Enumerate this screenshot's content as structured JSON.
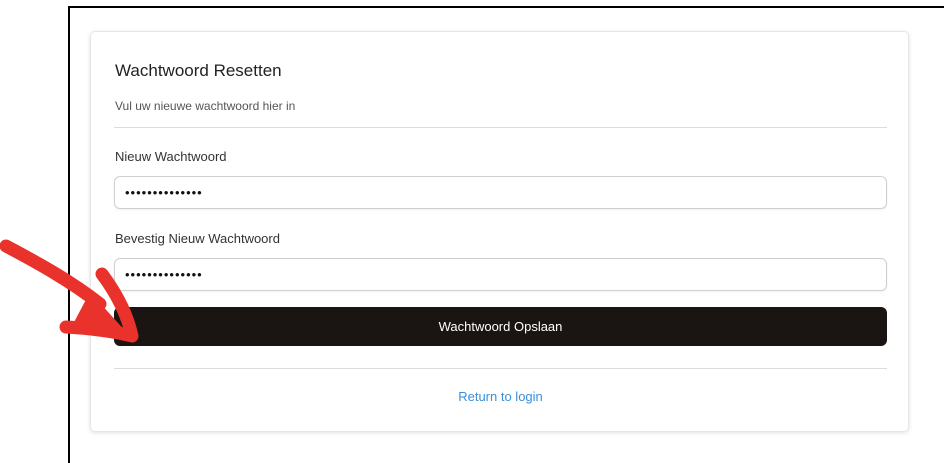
{
  "card": {
    "title": "Wachtwoord Resetten",
    "subtitle": "Vul uw nieuwe wachtwoord hier in"
  },
  "fields": {
    "new_password_label": "Nieuw Wachtwoord",
    "new_password_value": "••••••••••••••",
    "confirm_password_label": "Bevestig Nieuw Wachtwoord",
    "confirm_password_value": "••••••••••••••"
  },
  "actions": {
    "save_label": "Wachtwoord Opslaan",
    "return_label": "Return to login"
  },
  "annotation": {
    "arrow_icon": "red-arrow-icon",
    "arrow_color": "#e8322b"
  },
  "colors": {
    "button_bg": "#1a1512",
    "link": "#3b8fd6"
  }
}
